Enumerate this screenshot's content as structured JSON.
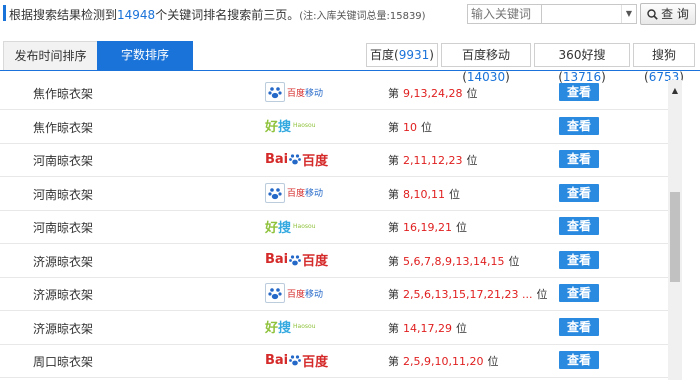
{
  "header": {
    "summary_prefix": "根据搜索结果检测到",
    "summary_count": "14948",
    "summary_suffix": "个关键词排名搜索前三页。",
    "summary_note": "(注:入库关键词总量:15839)",
    "search_placeholder": "输入关键词",
    "select_value": "",
    "search_button": "查 询"
  },
  "tabs": [
    {
      "label": "发布时间排序",
      "active": false
    },
    {
      "label": "字数排序",
      "active": true
    }
  ],
  "sources": [
    {
      "name": "百度",
      "count": "9931"
    },
    {
      "name": "百度移动",
      "count": "14030"
    },
    {
      "name": "360好搜",
      "count": "13716"
    },
    {
      "name": "搜狗",
      "count": "6753"
    }
  ],
  "rank_prefix": "第",
  "rank_suffix": "位",
  "view_label": "查看",
  "logos": {
    "baidu_mobile": {
      "a": "百度",
      "b": "移动"
    },
    "haosou": {
      "hao": "好",
      "sou": "搜",
      "en": "Haosou"
    },
    "baidu": {
      "bai": "Bai",
      "du": "百度"
    }
  },
  "rows": [
    {
      "keyword": "焦作晾衣架",
      "engine": "baidu_mobile",
      "positions": "9,13,24,28"
    },
    {
      "keyword": "焦作晾衣架",
      "engine": "haosou",
      "positions": "10"
    },
    {
      "keyword": "河南晾衣架",
      "engine": "baidu",
      "positions": "2,11,12,23"
    },
    {
      "keyword": "河南晾衣架",
      "engine": "baidu_mobile",
      "positions": "8,10,11"
    },
    {
      "keyword": "河南晾衣架",
      "engine": "haosou",
      "positions": "16,19,21"
    },
    {
      "keyword": "济源晾衣架",
      "engine": "baidu",
      "positions": "5,6,7,8,9,13,14,15"
    },
    {
      "keyword": "济源晾衣架",
      "engine": "baidu_mobile",
      "positions": "2,5,6,13,15,17,21,23 ..."
    },
    {
      "keyword": "济源晾衣架",
      "engine": "haosou",
      "positions": "14,17,29"
    },
    {
      "keyword": "周口晾衣架",
      "engine": "baidu",
      "positions": "2,5,9,10,11,20"
    }
  ]
}
